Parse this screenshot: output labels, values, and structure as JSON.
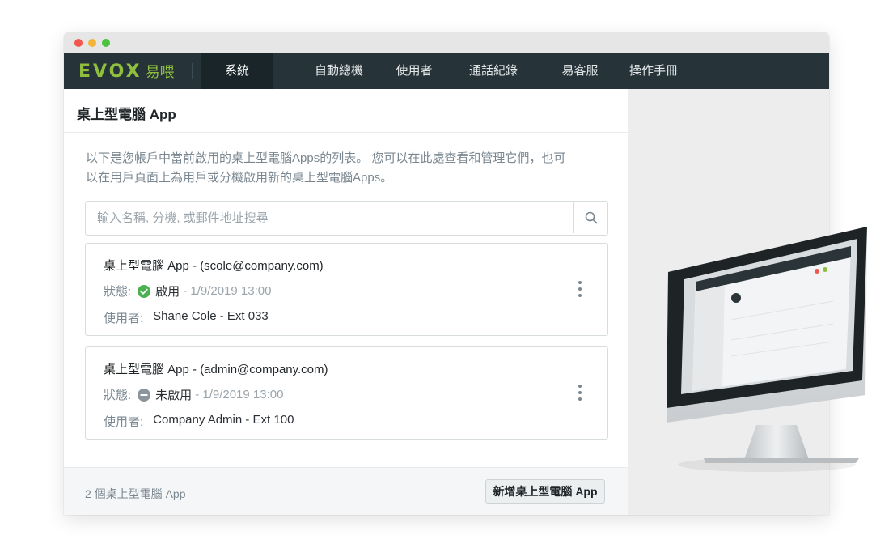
{
  "nav": {
    "logo_main": "EVOX",
    "logo_sub": "易喂",
    "items": [
      {
        "label": "系統"
      },
      {
        "label": "自動總機"
      },
      {
        "label": "使用者"
      },
      {
        "label": "通話紀錄"
      },
      {
        "label": "易客服"
      },
      {
        "label": "操作手冊"
      }
    ],
    "active_index": 0,
    "background": "#26343a",
    "accent": "#8fbf3c"
  },
  "page": {
    "title": "桌上型電腦 App",
    "description_line1": "以下是您帳戶中當前啟用的桌上型電腦Apps的列表。 您可以在此處查看和管理它們，也可",
    "description_line2": "以在用戶頁面上為用戶或分機啟用新的桌上型電腦Apps。"
  },
  "search": {
    "placeholder": "輸入名稱, 分機, 或郵件地址搜尋",
    "value": "",
    "icon": "search-icon"
  },
  "apps": [
    {
      "title": "桌上型電腦 App - (scole@company.com)",
      "status_label": "狀態:",
      "status_text": "啟用",
      "status_date": "- 1/9/2019 13:00",
      "status_icon": "check-circle-icon",
      "status_color": "#4cb051",
      "user_label": "使用者:",
      "user_value": "Shane Cole - Ext 033"
    },
    {
      "title": "桌上型電腦 App - (admin@company.com)",
      "status_label": "狀態:",
      "status_text": "未啟用",
      "status_date": "- 1/9/2019 13:00",
      "status_icon": "minus-circle-icon",
      "status_color": "#8a959c",
      "user_label": "使用者:",
      "user_value": "Company Admin - Ext 100"
    }
  ],
  "footer": {
    "count_text": "2 個桌上型電腦 App",
    "add_button_label": "新增桌上型電腦 App"
  }
}
